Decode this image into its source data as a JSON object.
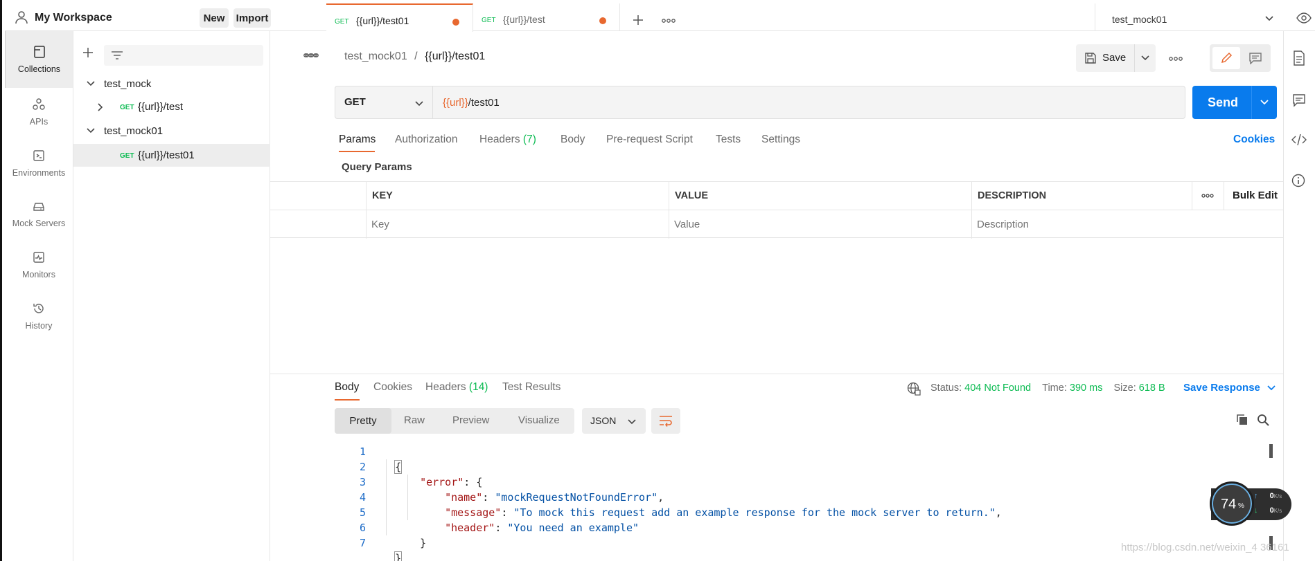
{
  "workspace": {
    "name": "My Workspace",
    "new_label": "New",
    "import_label": "Import"
  },
  "nav": [
    {
      "label": "Collections",
      "icon": "collections-icon"
    },
    {
      "label": "APIs",
      "icon": "apis-icon"
    },
    {
      "label": "Environments",
      "icon": "environments-icon"
    },
    {
      "label": "Mock Servers",
      "icon": "mock-servers-icon"
    },
    {
      "label": "Monitors",
      "icon": "monitors-icon"
    },
    {
      "label": "History",
      "icon": "history-icon"
    }
  ],
  "tree": {
    "collection1": "test_mock",
    "collection1_req_method": "GET",
    "collection1_req_name": "{{url}}/test",
    "collection2": "test_mock01",
    "collection2_req_method": "GET",
    "collection2_req_name": "{{url}}/test01"
  },
  "tabs": [
    {
      "method": "GET",
      "name": "{{url}}/test01"
    },
    {
      "method": "GET",
      "name": "{{url}}/test"
    }
  ],
  "environment": "test_mock01",
  "breadcrumb": {
    "collection": "test_mock01",
    "separator": "/",
    "request": "{{url}}/test01"
  },
  "save_label": "Save",
  "request": {
    "method": "GET",
    "url_var": "{{url}}",
    "url_path": "/test01",
    "send_label": "Send"
  },
  "request_tabs": {
    "params": "Params",
    "authorization": "Authorization",
    "headers": "Headers",
    "headers_count": "(7)",
    "body": "Body",
    "prerequest": "Pre-request Script",
    "tests": "Tests",
    "settings": "Settings",
    "cookies": "Cookies"
  },
  "query_params": {
    "title": "Query Params",
    "col_key": "KEY",
    "col_value": "VALUE",
    "col_description": "DESCRIPTION",
    "bulk_edit": "Bulk Edit",
    "key_placeholder": "Key",
    "value_placeholder": "Value",
    "description_placeholder": "Description"
  },
  "response": {
    "tabs": {
      "body": "Body",
      "cookies": "Cookies",
      "headers": "Headers",
      "headers_count": "(14)",
      "test_results": "Test Results"
    },
    "status_label": "Status:",
    "status_value": "404 Not Found",
    "time_label": "Time:",
    "time_value": "390 ms",
    "size_label": "Size:",
    "size_value": "618 B",
    "save_response": "Save Response",
    "views": {
      "pretty": "Pretty",
      "raw": "Raw",
      "preview": "Preview",
      "visualize": "Visualize"
    },
    "format": "JSON",
    "line_numbers": [
      "1",
      "2",
      "3",
      "4",
      "5",
      "6",
      "7"
    ],
    "code": {
      "l1": "{",
      "l2_key": "\"error\"",
      "l2_rest": ": {",
      "l3_key": "\"name\"",
      "l3_sep": ": ",
      "l3_val": "\"mockRequestNotFoundError\"",
      "l3_end": ",",
      "l4_key": "\"message\"",
      "l4_sep": ": ",
      "l4_val": "\"To mock this request add an example response for the mock server to return.\"",
      "l4_end": ",",
      "l5_key": "\"header\"",
      "l5_sep": ": ",
      "l5_val": "\"You need an example\"",
      "l6": "}",
      "l7": "}"
    }
  },
  "net_widget": {
    "percent": "74",
    "percent_sign": "%",
    "up": "0",
    "down": "0",
    "unit": "K/s"
  },
  "watermark": "https://blog.csdn.net/weixin_4  36161"
}
